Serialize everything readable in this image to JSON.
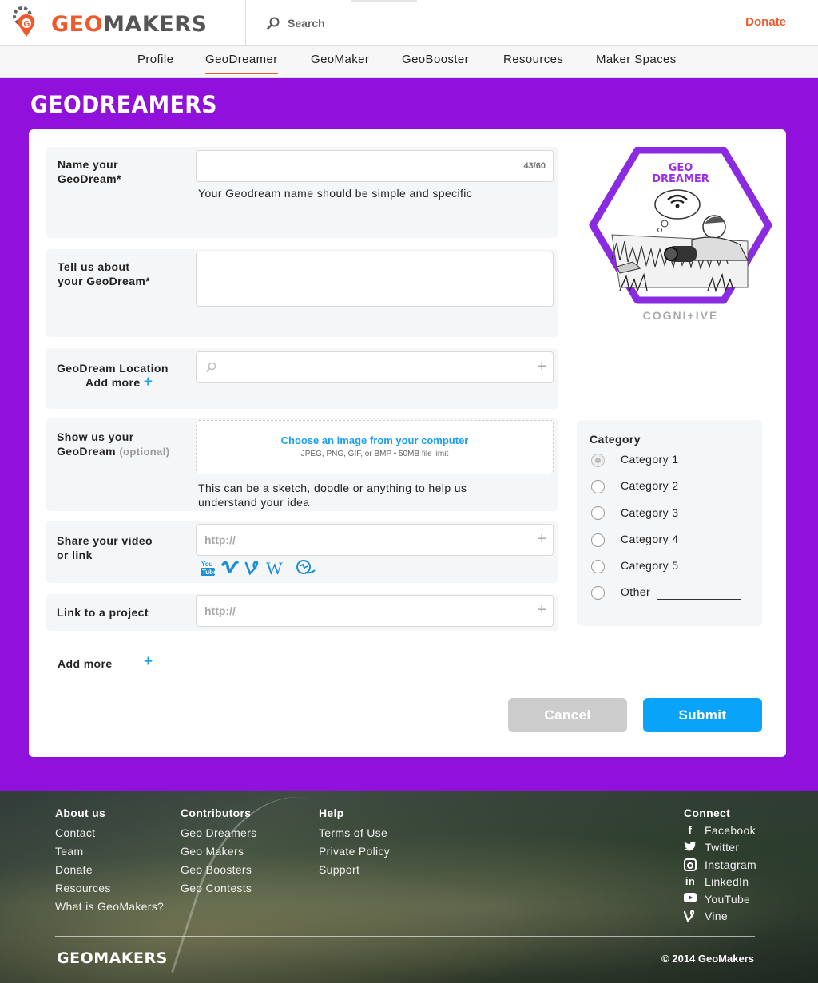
{
  "header": {
    "logo_geo": "GEO",
    "logo_makers": "MAKERS",
    "search_label": "Search",
    "donate": "Donate"
  },
  "nav": {
    "items": [
      "Profile",
      "GeoDreamer",
      "GeoMaker",
      "GeoBooster",
      "Resources",
      "Maker Spaces"
    ],
    "active": "GeoDreamer"
  },
  "page": {
    "title": "GEODREAMERS"
  },
  "form": {
    "name": {
      "label_line1": "Name your",
      "label_line2": "GeoDream*",
      "value": "",
      "counter": "43/60",
      "hint": "Your Geodream name should be simple and specific"
    },
    "about": {
      "label_line1": "Tell us about",
      "label_line2": "your GeoDream*",
      "value": ""
    },
    "location": {
      "label": "GeoDream Location",
      "add_more": "Add more",
      "plus": "+",
      "value": ""
    },
    "image": {
      "label_line1": "Show us your",
      "label_line2": "GeoDream",
      "optional": "(optional)",
      "choose": "Choose an image from your computer",
      "formats": "JPEG, PNG, GIF, or BMP • 50MB file limit",
      "hint_line1": "This can be a sketch, doodle or anything to help us",
      "hint_line2": "understand your idea"
    },
    "video": {
      "label_line1": "Share your video",
      "label_line2": "or link",
      "placeholder": "http://",
      "icons": [
        "youtube-icon",
        "vimeo-icon",
        "vine-icon",
        "wikipedia-icon",
        "other-link-icon"
      ]
    },
    "project": {
      "label": "Link to a project",
      "placeholder": "http://"
    },
    "add_more": "Add more",
    "add_more_plus": "+"
  },
  "badge": {
    "line1": "GEO",
    "line2": "DREAMER",
    "caption": "COGNI+IVE"
  },
  "category": {
    "title": "Category",
    "options": [
      "Category 1",
      "Category 2",
      "Category 3",
      "Category 4",
      "Category 5",
      "Other"
    ],
    "selected": "Category 1"
  },
  "buttons": {
    "cancel": "Cancel",
    "submit": "Submit"
  },
  "footer": {
    "about": {
      "heading": "About us",
      "links": [
        "Contact",
        "Team",
        "Donate",
        "Resources",
        "What is GeoMakers?"
      ]
    },
    "contributors": {
      "heading": "Contributors",
      "links": [
        "Geo Dreamers",
        "Geo Makers",
        "Geo Boosters",
        "Geo Contests"
      ]
    },
    "help": {
      "heading": "Help",
      "links": [
        "Terms of Use",
        "Private Policy",
        "Support"
      ]
    },
    "connect": {
      "heading": "Connect",
      "links": [
        "Facebook",
        "Twitter",
        "Instagram",
        "LinkedIn",
        "YouTube",
        "Vine"
      ]
    },
    "logo": "GEOMAKERS",
    "copyright": "© 2014 GeoMakers"
  },
  "colors": {
    "brand_orange": "#ef5a2a",
    "purple_band": "#9010dc",
    "submit_blue": "#0aa3fa",
    "cancel_gray": "#cccccc",
    "link_blue": "#1aa0f0"
  }
}
